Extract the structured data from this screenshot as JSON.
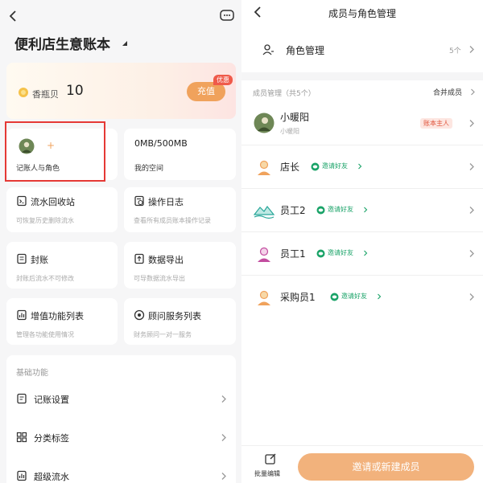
{
  "left": {
    "title": "便利店生意账本",
    "pearl": {
      "label": "香瓶贝",
      "count": "10",
      "recharge": "充值",
      "discount_tag": "优惠"
    },
    "members_card": {
      "label": "记账人与角色",
      "plus": "+"
    },
    "storage_card": {
      "value": "0MB/500MB",
      "label": "我的空间"
    },
    "tiles": [
      {
        "title": "流水回收站",
        "sub": "可恢复历史删除流水"
      },
      {
        "title": "操作日志",
        "sub": "查看所有成员账本操作记录"
      },
      {
        "title": "封账",
        "sub": "封账后流水不可修改"
      },
      {
        "title": "数据导出",
        "sub": "可导数据流水导出"
      },
      {
        "title": "增值功能列表",
        "sub": "管理各功能使用情况"
      },
      {
        "title": "顾问服务列表",
        "sub": "财务顾问一对一服务"
      }
    ],
    "basic_section": "基础功能",
    "list": [
      {
        "label": "记账设置"
      },
      {
        "label": "分类标签"
      },
      {
        "label": "超级流水"
      }
    ]
  },
  "right": {
    "title": "成员与角色管理",
    "role_mgmt": {
      "label": "角色管理",
      "count": "5个"
    },
    "member_section": "成员管理（共5个）",
    "merge_members": "合并成员",
    "owner": {
      "name": "小暖阳",
      "sub": "小暖阳",
      "badge": "账本主人"
    },
    "roles": [
      {
        "name": "店长",
        "invite": "邀请好友"
      },
      {
        "name": "员工2",
        "invite": "邀请好友"
      },
      {
        "name": "员工1",
        "invite": "邀请好友"
      },
      {
        "name": "采购员1",
        "invite": "邀请好友"
      }
    ],
    "batch_edit": "批量编辑",
    "invite_button": "邀请或新建成员"
  },
  "colors": {
    "accent_orange": "#f0a25c",
    "green": "#1aa368",
    "highlight_red": "#e53935",
    "owner_badge_bg": "#fde6e1",
    "owner_badge_text": "#e0533a"
  }
}
